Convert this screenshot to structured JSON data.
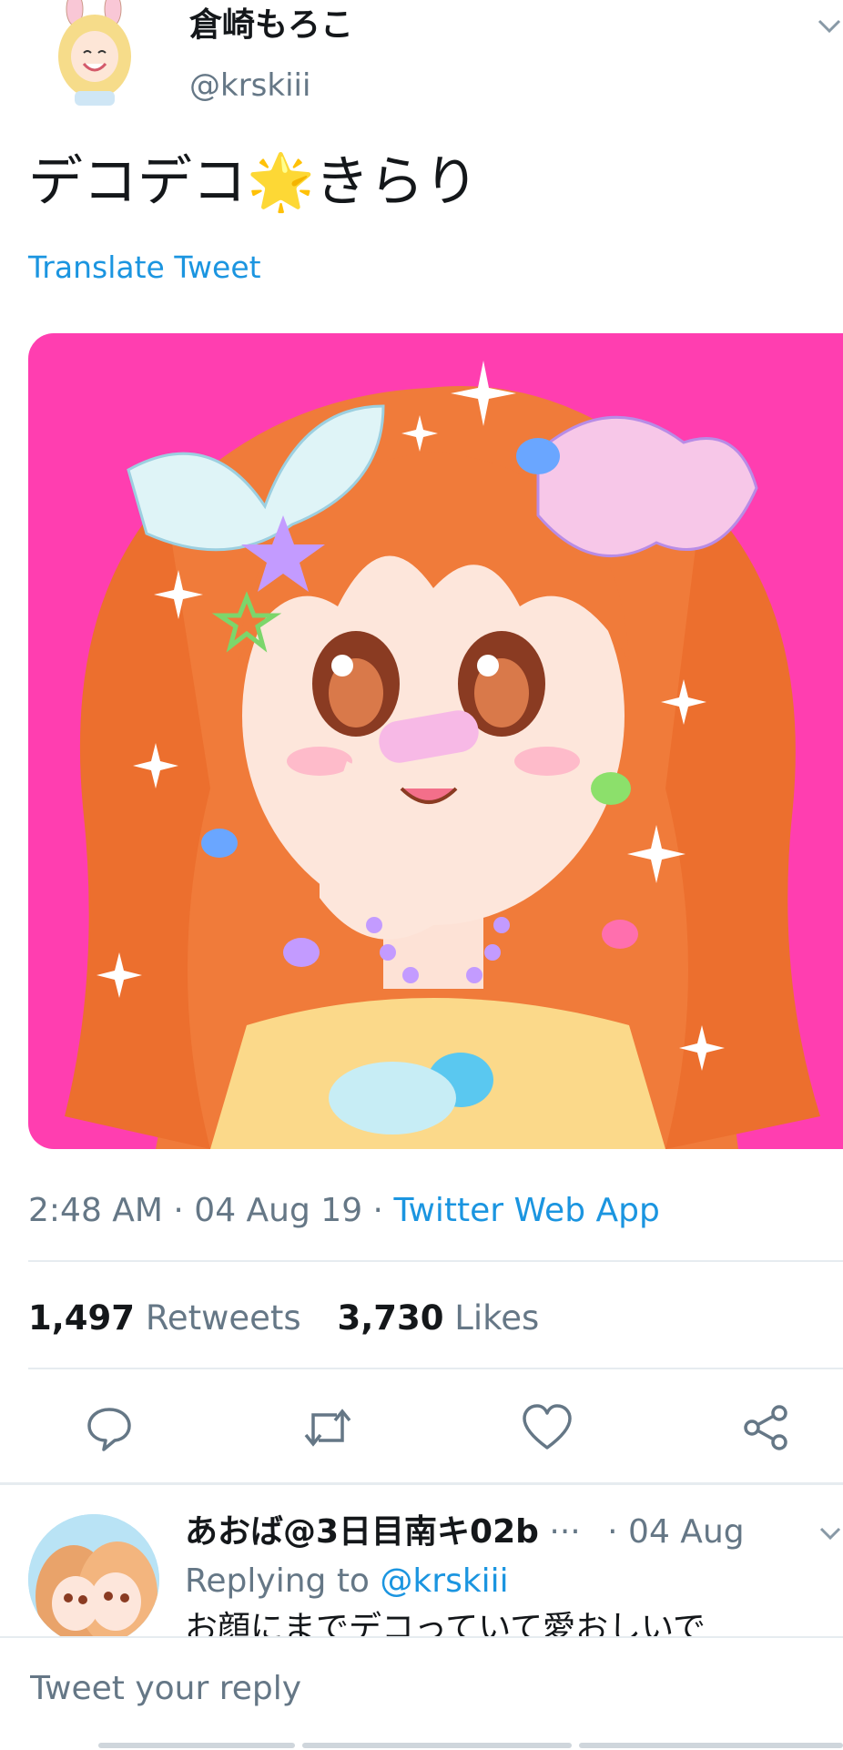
{
  "tweet": {
    "author_name": "倉崎もろこ",
    "author_handle": "@krskiii",
    "text_part1": "デコデコ",
    "text_emoji": "🌟",
    "text_part2": "きらり",
    "translate_label": "Translate Tweet",
    "timestamp": "2:48 AM · 04 Aug 19 ·",
    "source": "Twitter Web App",
    "retweets_count": "1,497",
    "retweets_label": "Retweets",
    "likes_count": "3,730",
    "likes_label": "Likes",
    "image_background": "#ff3eb0",
    "hair_color": "#f07b3a"
  },
  "actions": {
    "reply_icon": "comment-icon",
    "retweet_icon": "retweet-icon",
    "like_icon": "heart-icon",
    "share_icon": "share-icon"
  },
  "reply": {
    "author": "あおば@3日目南キ02b",
    "more": "···",
    "date": "· 04 Aug",
    "replying_prefix": "Replying to",
    "replying_handle": "@krskiii",
    "text_preview": "お顔にまでデコっていて愛おしいで"
  },
  "composer": {
    "placeholder": "Tweet your reply"
  }
}
